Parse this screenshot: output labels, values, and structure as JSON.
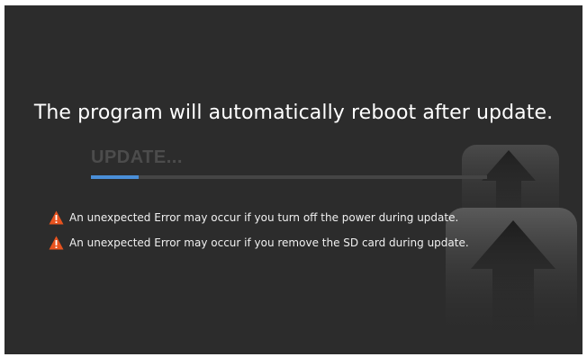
{
  "dialog": {
    "message": "The program will automatically reboot after update.",
    "status_label": "UPDATE...",
    "progress": 0.12,
    "warnings": [
      {
        "icon": "warning-icon",
        "text": "An unexpected Error may occur if you turn off the power during update."
      },
      {
        "icon": "warning-icon",
        "text": "An unexpected Error may occur if you remove the SD card during update."
      }
    ]
  },
  "colors": {
    "background": "#2c2c2c",
    "progress_fill": "#4a8fd8",
    "warning_icon": "#e8531f"
  },
  "decor": {
    "icon": "upload-arrow-icon"
  }
}
